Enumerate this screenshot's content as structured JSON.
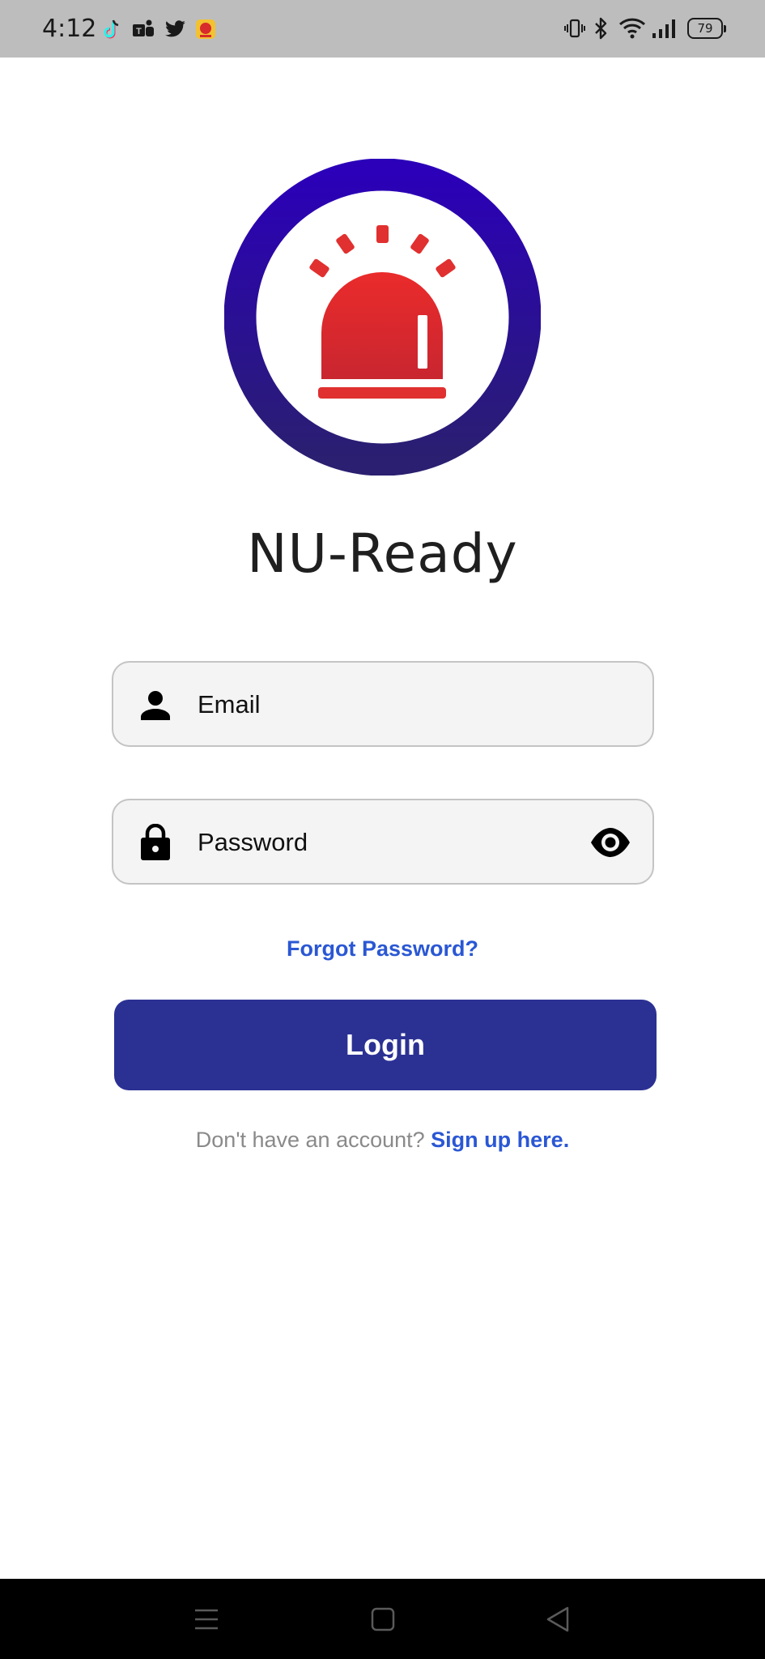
{
  "status_bar": {
    "time": "4:12",
    "notification_icons": [
      "tiktok-icon",
      "teams-icon",
      "twitter-icon",
      "app-badge-icon"
    ],
    "system_icons": [
      "vibrate-icon",
      "bluetooth-icon",
      "wifi-icon",
      "signal-icon"
    ],
    "battery_level": "79"
  },
  "app": {
    "title": "NU-Ready",
    "logo_icon": "siren-icon",
    "colors": {
      "ring_top": "#2b00b8",
      "ring_bottom": "#2a1f70",
      "siren_red": "#e4282c",
      "primary_button": "#2b3193",
      "link_blue": "#2a57d4"
    }
  },
  "login_form": {
    "email_placeholder": "Email",
    "password_placeholder": "Password",
    "forgot_password": "Forgot Password?",
    "login_button": "Login",
    "signup_prompt": "Don't have an account?",
    "signup_link": "Sign up here."
  },
  "nav_bar": {
    "buttons": [
      "menu-icon",
      "home-icon",
      "back-icon"
    ]
  }
}
